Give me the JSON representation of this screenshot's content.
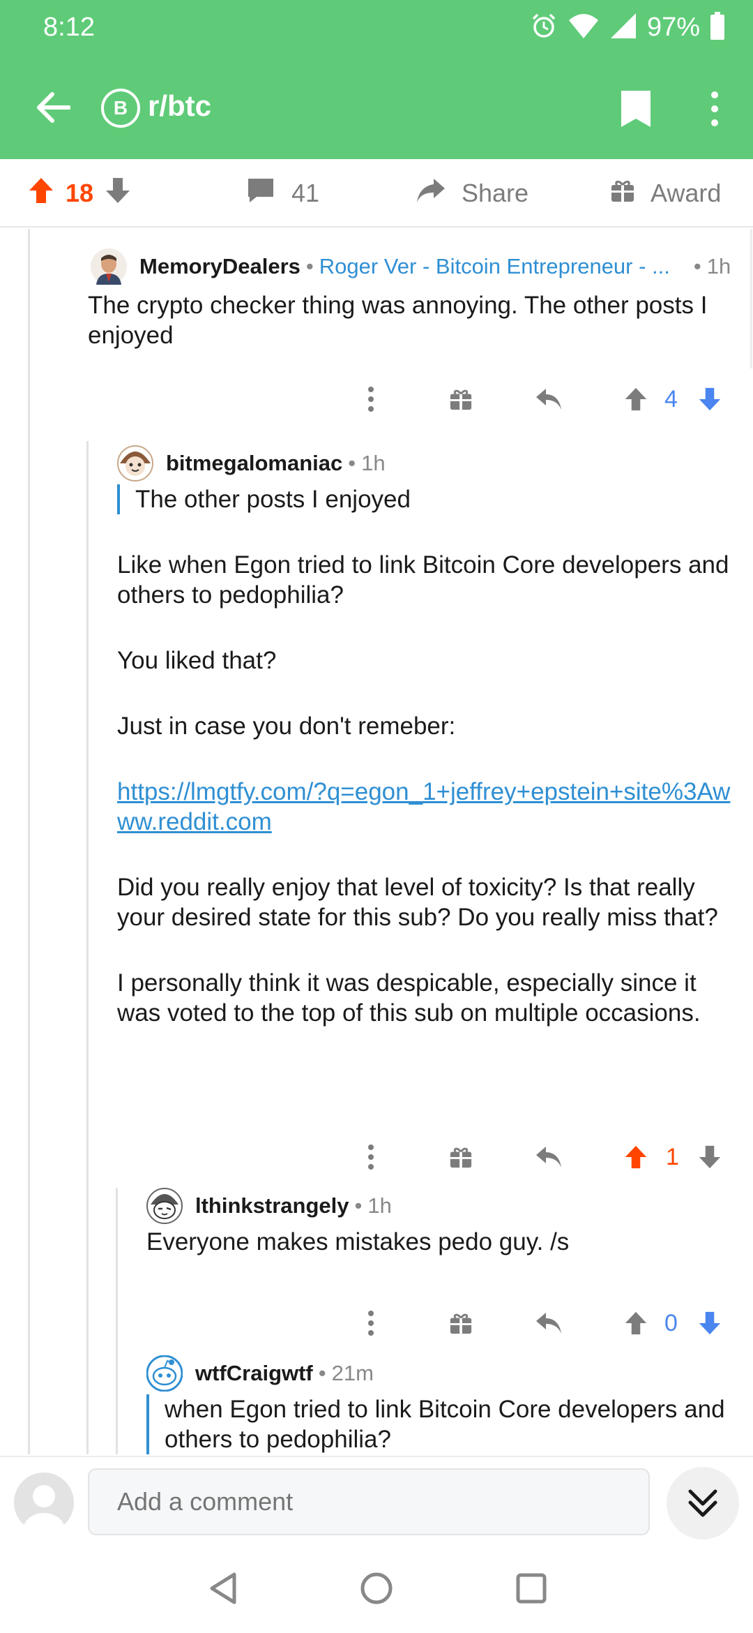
{
  "status": {
    "time": "8:12",
    "battery": "97%"
  },
  "header": {
    "subreddit": "r/btc",
    "sub_icon_letter": "B"
  },
  "post_actions": {
    "score": "18",
    "comments": "41",
    "share_label": "Share",
    "award_label": "Award"
  },
  "comments": [
    {
      "username": "MemoryDealers",
      "flair": "Roger Ver - Bitcoin Entrepreneur - ...",
      "time": "1h",
      "body": [
        "The crypto checker thing was annoying.  The other posts I enjoyed"
      ],
      "score": "4"
    },
    {
      "username": "bitmegalomaniac",
      "time": "1h",
      "quote": "The other posts I enjoyed",
      "paragraphs": [
        "Like when Egon tried to link Bitcoin Core developers and others to pedophilia?",
        "You liked that?",
        "Just in case you don't remeber:"
      ],
      "link": "https://lmgtfy.com/?q=egon_1+jeffrey+epstein+site%3Awww.reddit.com",
      "paragraphs_after": [
        "Did you really enjoy that level of toxicity?  Is that really your desired state for this sub?  Do you really miss that?",
        "I personally think it was despicable, especially since it was voted to the top of this sub on multiple occasions."
      ],
      "score": "1"
    },
    {
      "username": "lthinkstrangely",
      "time": "1h",
      "body": [
        "Everyone makes mistakes pedo guy. /s"
      ],
      "score": "0"
    },
    {
      "username": "wtfCraigwtf",
      "time": "21m",
      "quote": "when Egon tried to link Bitcoin Core developers and others to pedophilia?"
    }
  ],
  "compose": {
    "placeholder": "Add a comment"
  },
  "colors": {
    "header": "#5fcb78",
    "upvote": "#ff4500",
    "downvote": "#4a85f0",
    "link": "#2f8fd3"
  }
}
